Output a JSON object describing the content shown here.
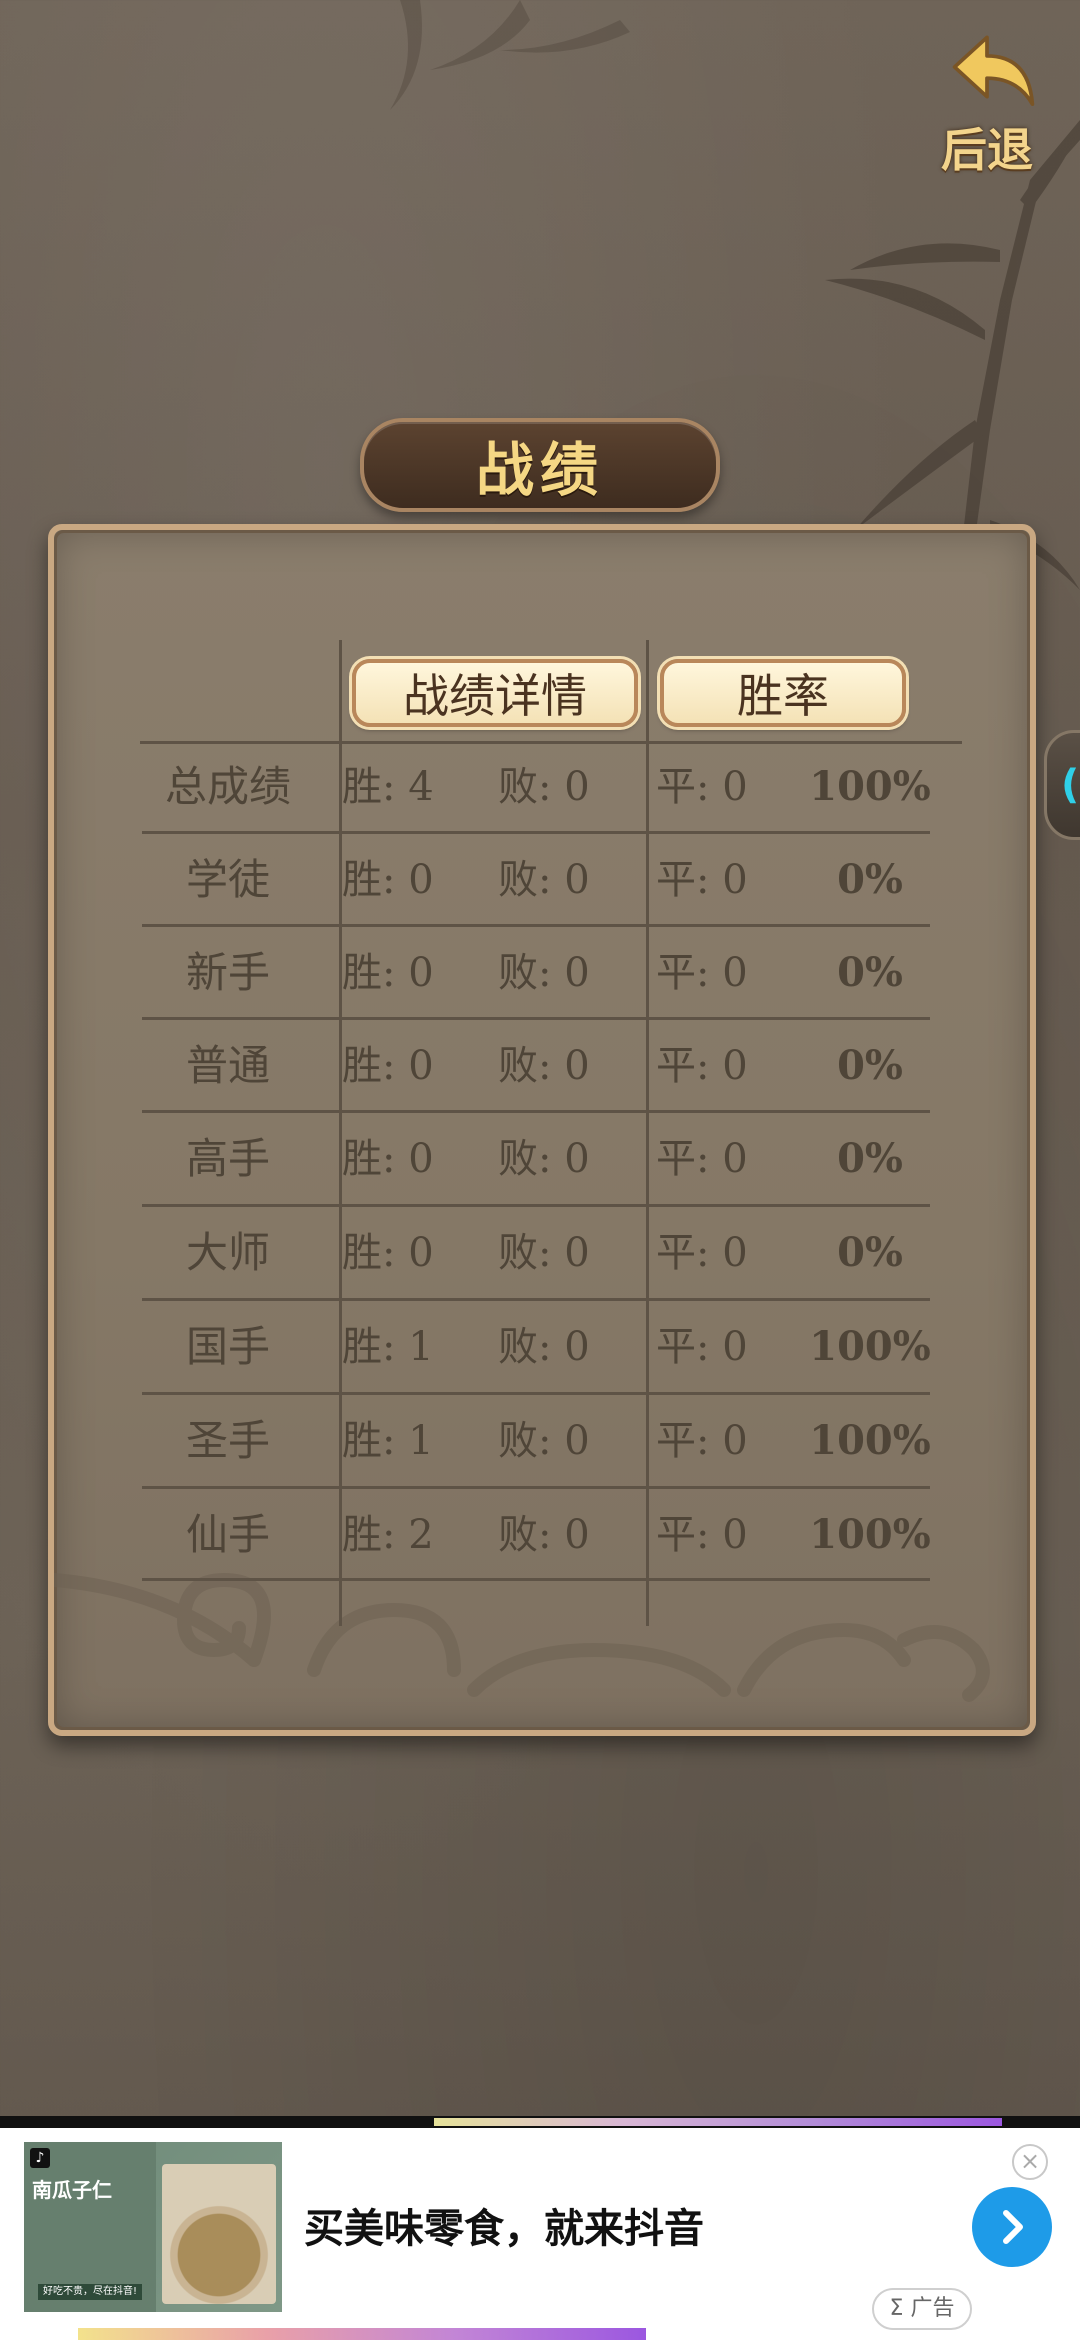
{
  "header": {
    "back_label": "后退",
    "title": "战绩"
  },
  "table": {
    "tabs": [
      {
        "label": "战绩详情"
      },
      {
        "label": "胜率"
      }
    ],
    "rows": [
      {
        "name": "总成绩",
        "win": "胜: 4",
        "loss": "败: 0",
        "draw": "平: 0",
        "rate": "100%"
      },
      {
        "name": "学徒",
        "win": "胜: 0",
        "loss": "败: 0",
        "draw": "平: 0",
        "rate": "0%"
      },
      {
        "name": "新手",
        "win": "胜: 0",
        "loss": "败: 0",
        "draw": "平: 0",
        "rate": "0%"
      },
      {
        "name": "普通",
        "win": "胜: 0",
        "loss": "败: 0",
        "draw": "平: 0",
        "rate": "0%"
      },
      {
        "name": "高手",
        "win": "胜: 0",
        "loss": "败: 0",
        "draw": "平: 0",
        "rate": "0%"
      },
      {
        "name": "大师",
        "win": "胜: 0",
        "loss": "败: 0",
        "draw": "平: 0",
        "rate": "0%"
      },
      {
        "name": "国手",
        "win": "胜: 1",
        "loss": "败: 0",
        "draw": "平: 0",
        "rate": "100%"
      },
      {
        "name": "圣手",
        "win": "胜: 1",
        "loss": "败: 0",
        "draw": "平: 0",
        "rate": "100%"
      },
      {
        "name": "仙手",
        "win": "胜: 2",
        "loss": "败: 0",
        "draw": "平: 0",
        "rate": "100%"
      }
    ]
  },
  "side_tab": {
    "glyph": "("
  },
  "ad": {
    "thumb_title": "南瓜子仁",
    "thumb_tag": "好吃不贵，尽在抖音!",
    "headline": "买美味零食，就来抖音",
    "badge": "Σ 广告",
    "close_glyph": "×",
    "accent": "#1e9be8"
  },
  "colors": {
    "title_gold": "#f5d784",
    "panel_border": "#c9a882",
    "text_brown": "#4f4538"
  }
}
